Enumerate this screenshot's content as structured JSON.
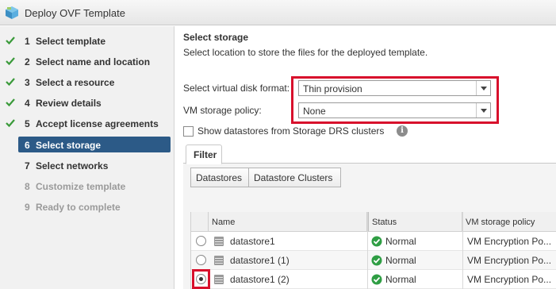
{
  "window": {
    "title": "Deploy OVF Template",
    "icon": "vm-package-icon"
  },
  "sidebar": {
    "steps": [
      {
        "num": "1",
        "label": "Select template",
        "state": "done"
      },
      {
        "num": "2",
        "label": "Select name and location",
        "state": "done"
      },
      {
        "num": "3",
        "label": "Select a resource",
        "state": "done"
      },
      {
        "num": "4",
        "label": "Review details",
        "state": "done"
      },
      {
        "num": "5",
        "label": "Accept license agreements",
        "state": "done"
      },
      {
        "num": "6",
        "label": "Select storage",
        "state": "current"
      },
      {
        "num": "7",
        "label": "Select networks",
        "state": "pending"
      },
      {
        "num": "8",
        "label": "Customize template",
        "state": "disabled"
      },
      {
        "num": "9",
        "label": "Ready to complete",
        "state": "disabled"
      }
    ]
  },
  "main": {
    "heading": "Select storage",
    "subtitle": "Select location to store the files for the deployed template.",
    "disk_format": {
      "label": "Select virtual disk format:",
      "value": "Thin provision"
    },
    "storage_policy": {
      "label": "VM storage policy:",
      "value": "None"
    },
    "show_drs": {
      "label": "Show datastores from Storage DRS clusters",
      "checked": false
    },
    "tabs": {
      "filter": "Filter"
    },
    "segments": {
      "datastores": "Datastores",
      "clusters": "Datastore Clusters"
    },
    "table": {
      "columns": {
        "name": "Name",
        "status": "Status",
        "policy": "VM storage policy"
      },
      "rows": [
        {
          "name": "datastore1",
          "status": "Normal",
          "policy": "VM Encryption Po...",
          "selected": false
        },
        {
          "name": "datastore1 (1)",
          "status": "Normal",
          "policy": "VM Encryption Po...",
          "selected": false
        },
        {
          "name": "datastore1 (2)",
          "status": "Normal",
          "policy": "VM Encryption Po...",
          "selected": true
        }
      ]
    }
  },
  "colors": {
    "accent_selected": "#2c5a87",
    "highlight_box": "#d8102c",
    "check_green": "#3a9a3a",
    "status_green": "#2f9e44"
  }
}
